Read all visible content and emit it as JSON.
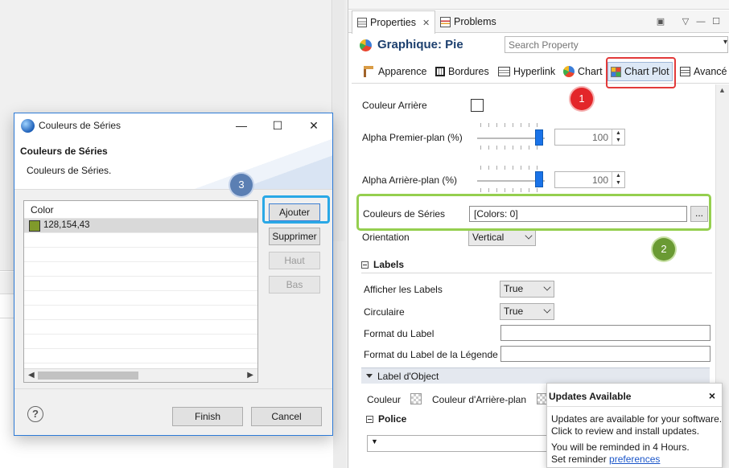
{
  "properties_view": {
    "tabs": [
      {
        "label": "Properties",
        "close": "✕"
      },
      {
        "label": "Problems"
      }
    ],
    "title": "Graphique: Pie",
    "search": {
      "placeholder": "Search Property"
    },
    "subtabs": [
      "Apparence",
      "Bordures",
      "Hyperlink",
      "Chart",
      "Chart Plot",
      "Avancé"
    ],
    "fields": {
      "couleur_arriere": "Couleur Arrière",
      "alpha_premier": "Alpha Premier-plan (%)",
      "alpha_premier_value": "100",
      "alpha_premier_level": 100,
      "alpha_arriere": "Alpha Arrière-plan (%)",
      "alpha_arriere_value": "100",
      "alpha_arriere_level": 100,
      "couleurs_series": "Couleurs de Séries",
      "couleurs_series_value": "[Colors: 0]",
      "browse_button": "...",
      "orientation": "Orientation",
      "orientation_value": "Vertical"
    },
    "labels_section": {
      "title": "Labels",
      "afficher": "Afficher les Labels",
      "afficher_value": "True",
      "circulaire": "Circulaire",
      "circulaire_value": "True",
      "format_label": "Format du Label",
      "format_legende": "Format du Label de la Légende"
    },
    "label_object": {
      "title": "Label d'Object",
      "couleur": "Couleur",
      "couleur_arriere": "Couleur d'Arrière-plan"
    },
    "police_section": {
      "title": "Police"
    }
  },
  "annotations": {
    "badge1": "1",
    "badge2": "2",
    "badge3": "3",
    "colors": {
      "red": "#e3262a",
      "green": "#95cf4f",
      "blue": "#2aa8e6"
    }
  },
  "dialog": {
    "title": "Couleurs de Séries",
    "heading": "Couleurs de Séries",
    "description": "Couleurs de Séries.",
    "table": {
      "header": "Color",
      "rows": [
        {
          "value": "128,154,43",
          "color": "#809a2b"
        }
      ]
    },
    "buttons": {
      "add": "Ajouter",
      "remove": "Supprimer",
      "up": "Haut",
      "down": "Bas"
    },
    "footer": {
      "finish": "Finish",
      "cancel": "Cancel"
    },
    "window": {
      "minimize": "—",
      "maximize": "☐",
      "close": "✕"
    }
  },
  "notification": {
    "title": "Updates Available",
    "close": "×",
    "line1": "Updates are available for your software.",
    "line2": "Click to review and install updates.",
    "line3": "You will be reminded in 4 Hours.",
    "line4_prefix": "Set reminder ",
    "line4_link": "preferences"
  }
}
